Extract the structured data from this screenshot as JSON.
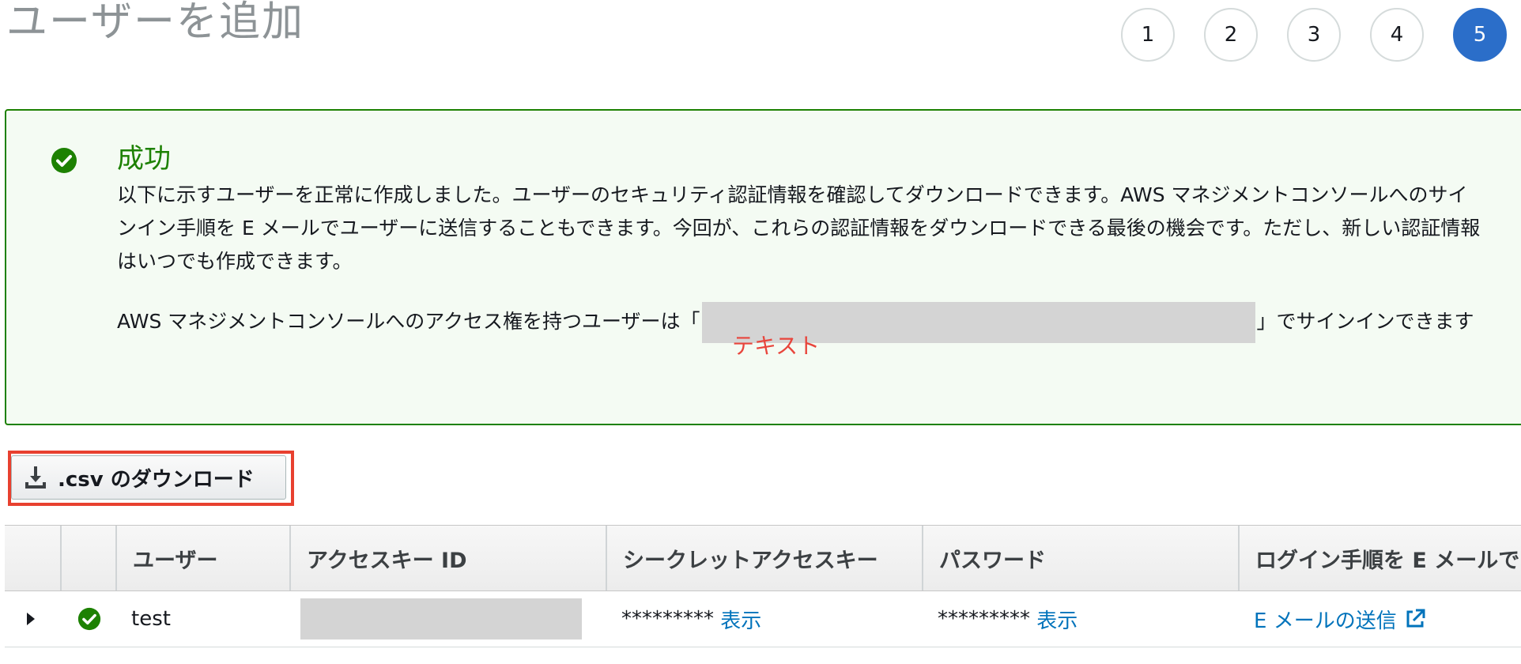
{
  "page": {
    "title": "ユーザーを追加"
  },
  "steps": [
    {
      "label": "1",
      "active": false
    },
    {
      "label": "2",
      "active": false
    },
    {
      "label": "3",
      "active": false
    },
    {
      "label": "4",
      "active": false
    },
    {
      "label": "5",
      "active": true
    }
  ],
  "alert": {
    "title": "成功",
    "body": "以下に示すユーザーを正常に作成しました。ユーザーのセキュリティ認証情報を確認してダウンロードできます。AWS マネジメントコンソールへのサインイン手順を E メールでユーザーに送信することもできます。今回が、これらの認証情報をダウンロードできる最後の機会です。ただし、新しい認証情報はいつでも作成できます。",
    "signin_prefix": "AWS マネジメントコンソールへのアクセス権を持つユーザーは「",
    "signin_suffix": "」でサインインできます",
    "annotation": "テキスト"
  },
  "toolbar": {
    "csv_download_label": ".csv のダウンロード"
  },
  "table": {
    "columns": [
      "",
      "",
      "ユーザー",
      "アクセスキー ID",
      "シークレットアクセスキー",
      "パスワード",
      "ログイン手順を E メールで"
    ],
    "rows": [
      {
        "user": "test",
        "secret_masked": "*********",
        "secret_show": "表示",
        "password_masked": "*********",
        "password_show": "表示",
        "email_link": "E メールの送信"
      }
    ]
  },
  "colors": {
    "success": "#1d8102",
    "link": "#0073bb",
    "active_step": "#2b6ec9",
    "highlight": "#e8402f"
  },
  "icons": {
    "alert": "check-circle-icon",
    "download": "download-icon",
    "expand": "caret-right-icon",
    "row_status": "check-circle-icon",
    "external": "external-link-icon"
  }
}
